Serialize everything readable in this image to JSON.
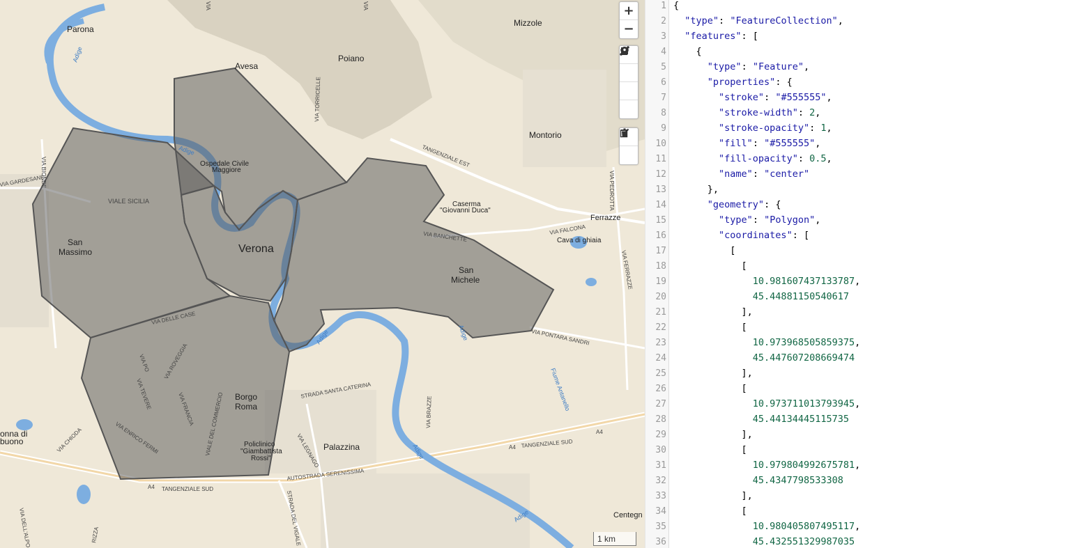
{
  "map": {
    "labels": {
      "parona": "Parona",
      "avesa": "Avesa",
      "poiano": "Poiano",
      "mizzole": "Mizzole",
      "montorio": "Montorio",
      "verona": "Verona",
      "san": "San",
      "massimo": "Massimo",
      "san_m": "San",
      "michele": "Michele",
      "borgo": "Borgo",
      "roma": "Roma",
      "palazzina": "Palazzina",
      "ferrazze": "Ferrazze",
      "cava": "Cava di ghiaia",
      "caserma": "Caserma",
      "caserma2": "\"Giovanni Duca\"",
      "ospedale": "Ospedale Civile",
      "ospedale2": "Maggiore",
      "policlinico": "Policlinico",
      "policlinico2": "\"Giambattista",
      "policlinico3": "Rossi\"",
      "centegn": "Centegn",
      "onna": "onna di",
      "buono": "buono",
      "viale_sicilia": "VIALE SICILIA",
      "via_gardesane": "VIA GARDESANE",
      "via_bionde": "VIA BIONDE",
      "via_delle_case": "VIA DELLE CASE",
      "via_po": "VIA PO",
      "via_roveggia": "VIA ROVEGGIA",
      "via_tevere": "VIA TEVERE",
      "via_francia": "VIA FRANCIA",
      "via_commercio": "VIALE DEL COMMERCIO",
      "via_fermi": "VIA ENRICO FERMI",
      "via_chioda": "VIA CHIODA",
      "via_legnago": "VIA LEGNAGO",
      "strada_caterina": "STRADA SANTA CATERINA",
      "via_brazze": "VIA BRAZZE",
      "via_banchette": "VIA BANCHETTE",
      "via_falcona": "VIA FALCONA",
      "via_pedrotta": "VIA PEDROTTA",
      "via_ferrazze": "VIA FERRAZZE",
      "via_pontara": "VIA PONTARA SANDRI",
      "tangenziale_est": "TANGENZIALE EST",
      "tangenziale_sud": "TANGENZIALE SUD",
      "tangenziale_sud2": "TANGENZIALE SUD",
      "autostrada": "AUTOSTRADA SERENISSIMA",
      "a4a": "A4",
      "a4b": "A4",
      "a4c": "A4",
      "via_torricelle": "VIA TORRICELLE",
      "adige1": "Adige",
      "adige2": "Adige",
      "adige3": "Adige",
      "adige4": "Adige",
      "adige5": "Adige",
      "adige6": "Adige",
      "fiume": "Fiume Antanello",
      "strada_vigale": "STRADA DEL VIGALE",
      "via_alpo": "VIA DELL'ALPO",
      "rizza": "RIZZA",
      "via_top": "VIA",
      "via_top2": "VIA"
    },
    "scale_label": "1 km",
    "polygon_fill": "#555555",
    "toolbar": {
      "zoom_in": "+",
      "zoom_out": "−"
    }
  },
  "editor": {
    "line_numbers": [
      "1",
      "2",
      "3",
      "4",
      "5",
      "6",
      "7",
      "8",
      "9",
      "10",
      "11",
      "12",
      "13",
      "14",
      "15",
      "16",
      "17",
      "18",
      "19",
      "20",
      "21",
      "22",
      "23",
      "24",
      "25",
      "26",
      "27",
      "28",
      "29",
      "30",
      "31",
      "32",
      "33",
      "34",
      "35",
      "36"
    ],
    "json": {
      "type_key": "\"type\"",
      "type_val": "\"FeatureCollection\"",
      "features_key": "\"features\"",
      "f_type_key": "\"type\"",
      "f_type_val": "\"Feature\"",
      "props_key": "\"properties\"",
      "stroke_key": "\"stroke\"",
      "stroke_val": "\"#555555\"",
      "sw_key": "\"stroke-width\"",
      "sw_val": "2",
      "so_key": "\"stroke-opacity\"",
      "so_val": "1",
      "fill_key": "\"fill\"",
      "fill_val": "\"#555555\"",
      "fo_key": "\"fill-opacity\"",
      "fo_val": "0.5",
      "name_key": "\"name\"",
      "name_val": "\"center\"",
      "geom_key": "\"geometry\"",
      "g_type_key": "\"type\"",
      "g_type_val": "\"Polygon\"",
      "coords_key": "\"coordinates\"",
      "c1a": "10.981607437133787",
      "c1b": "45.44881150540617",
      "c2a": "10.973968505859375",
      "c2b": "45.447607208669474",
      "c3a": "10.973711013793945",
      "c3b": "45.44134445115735",
      "c4a": "10.979804992675781",
      "c4b": "45.4347798533308",
      "c5a": "10.980405807495117",
      "c5b": "45.432551329987035"
    }
  }
}
